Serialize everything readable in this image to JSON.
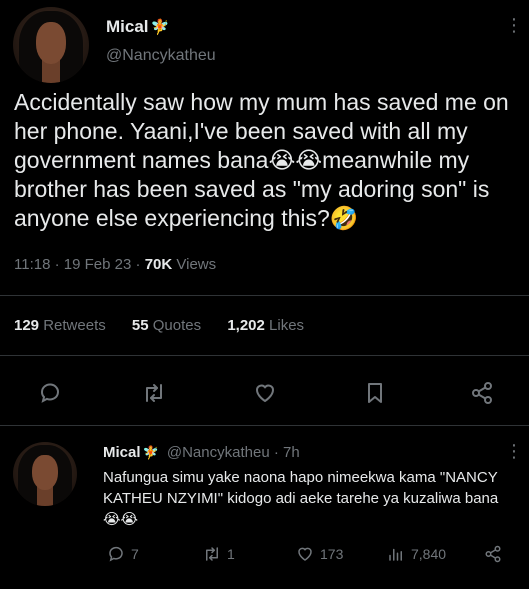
{
  "tweet": {
    "name": "Mical",
    "name_emoji": "🧚",
    "handle": "@Nancykatheu",
    "text": "Accidentally saw how my mum has saved me on her phone. Yaani,I've been saved with all my government names bana😭😭meanwhile my brother has been saved as \"my adoring son\" is anyone else experiencing this?🤣",
    "time": "11:18",
    "date": "19 Feb 23",
    "views_count": "70K",
    "views_label": "Views",
    "retweets_count": "129",
    "retweets_label": "Retweets",
    "quotes_count": "55",
    "quotes_label": "Quotes",
    "likes_count": "1,202",
    "likes_label": "Likes"
  },
  "reply": {
    "name": "Mical",
    "name_emoji": "🧚",
    "handle": "@Nancykatheu",
    "age": "7h",
    "text": "Nafungua simu yake naona hapo nimeekwa kama \"NANCY KATHEU NZYIMI\" kidogo adi aeke tarehe ya kuzaliwa bana😭😭",
    "replies": "7",
    "retweets": "1",
    "likes": "173",
    "views": "7,840"
  },
  "icons": {
    "reply": "speech-bubble-icon",
    "retweet": "retweet-arrows-icon",
    "like": "heart-icon",
    "bookmark": "bookmark-icon",
    "share": "share-icon",
    "views": "bar-chart-icon",
    "more": "more-vertical-icon"
  },
  "colors": {
    "background": "#000000",
    "text": "#e7e9ea",
    "muted": "#71767b",
    "divider": "#2f3336"
  }
}
